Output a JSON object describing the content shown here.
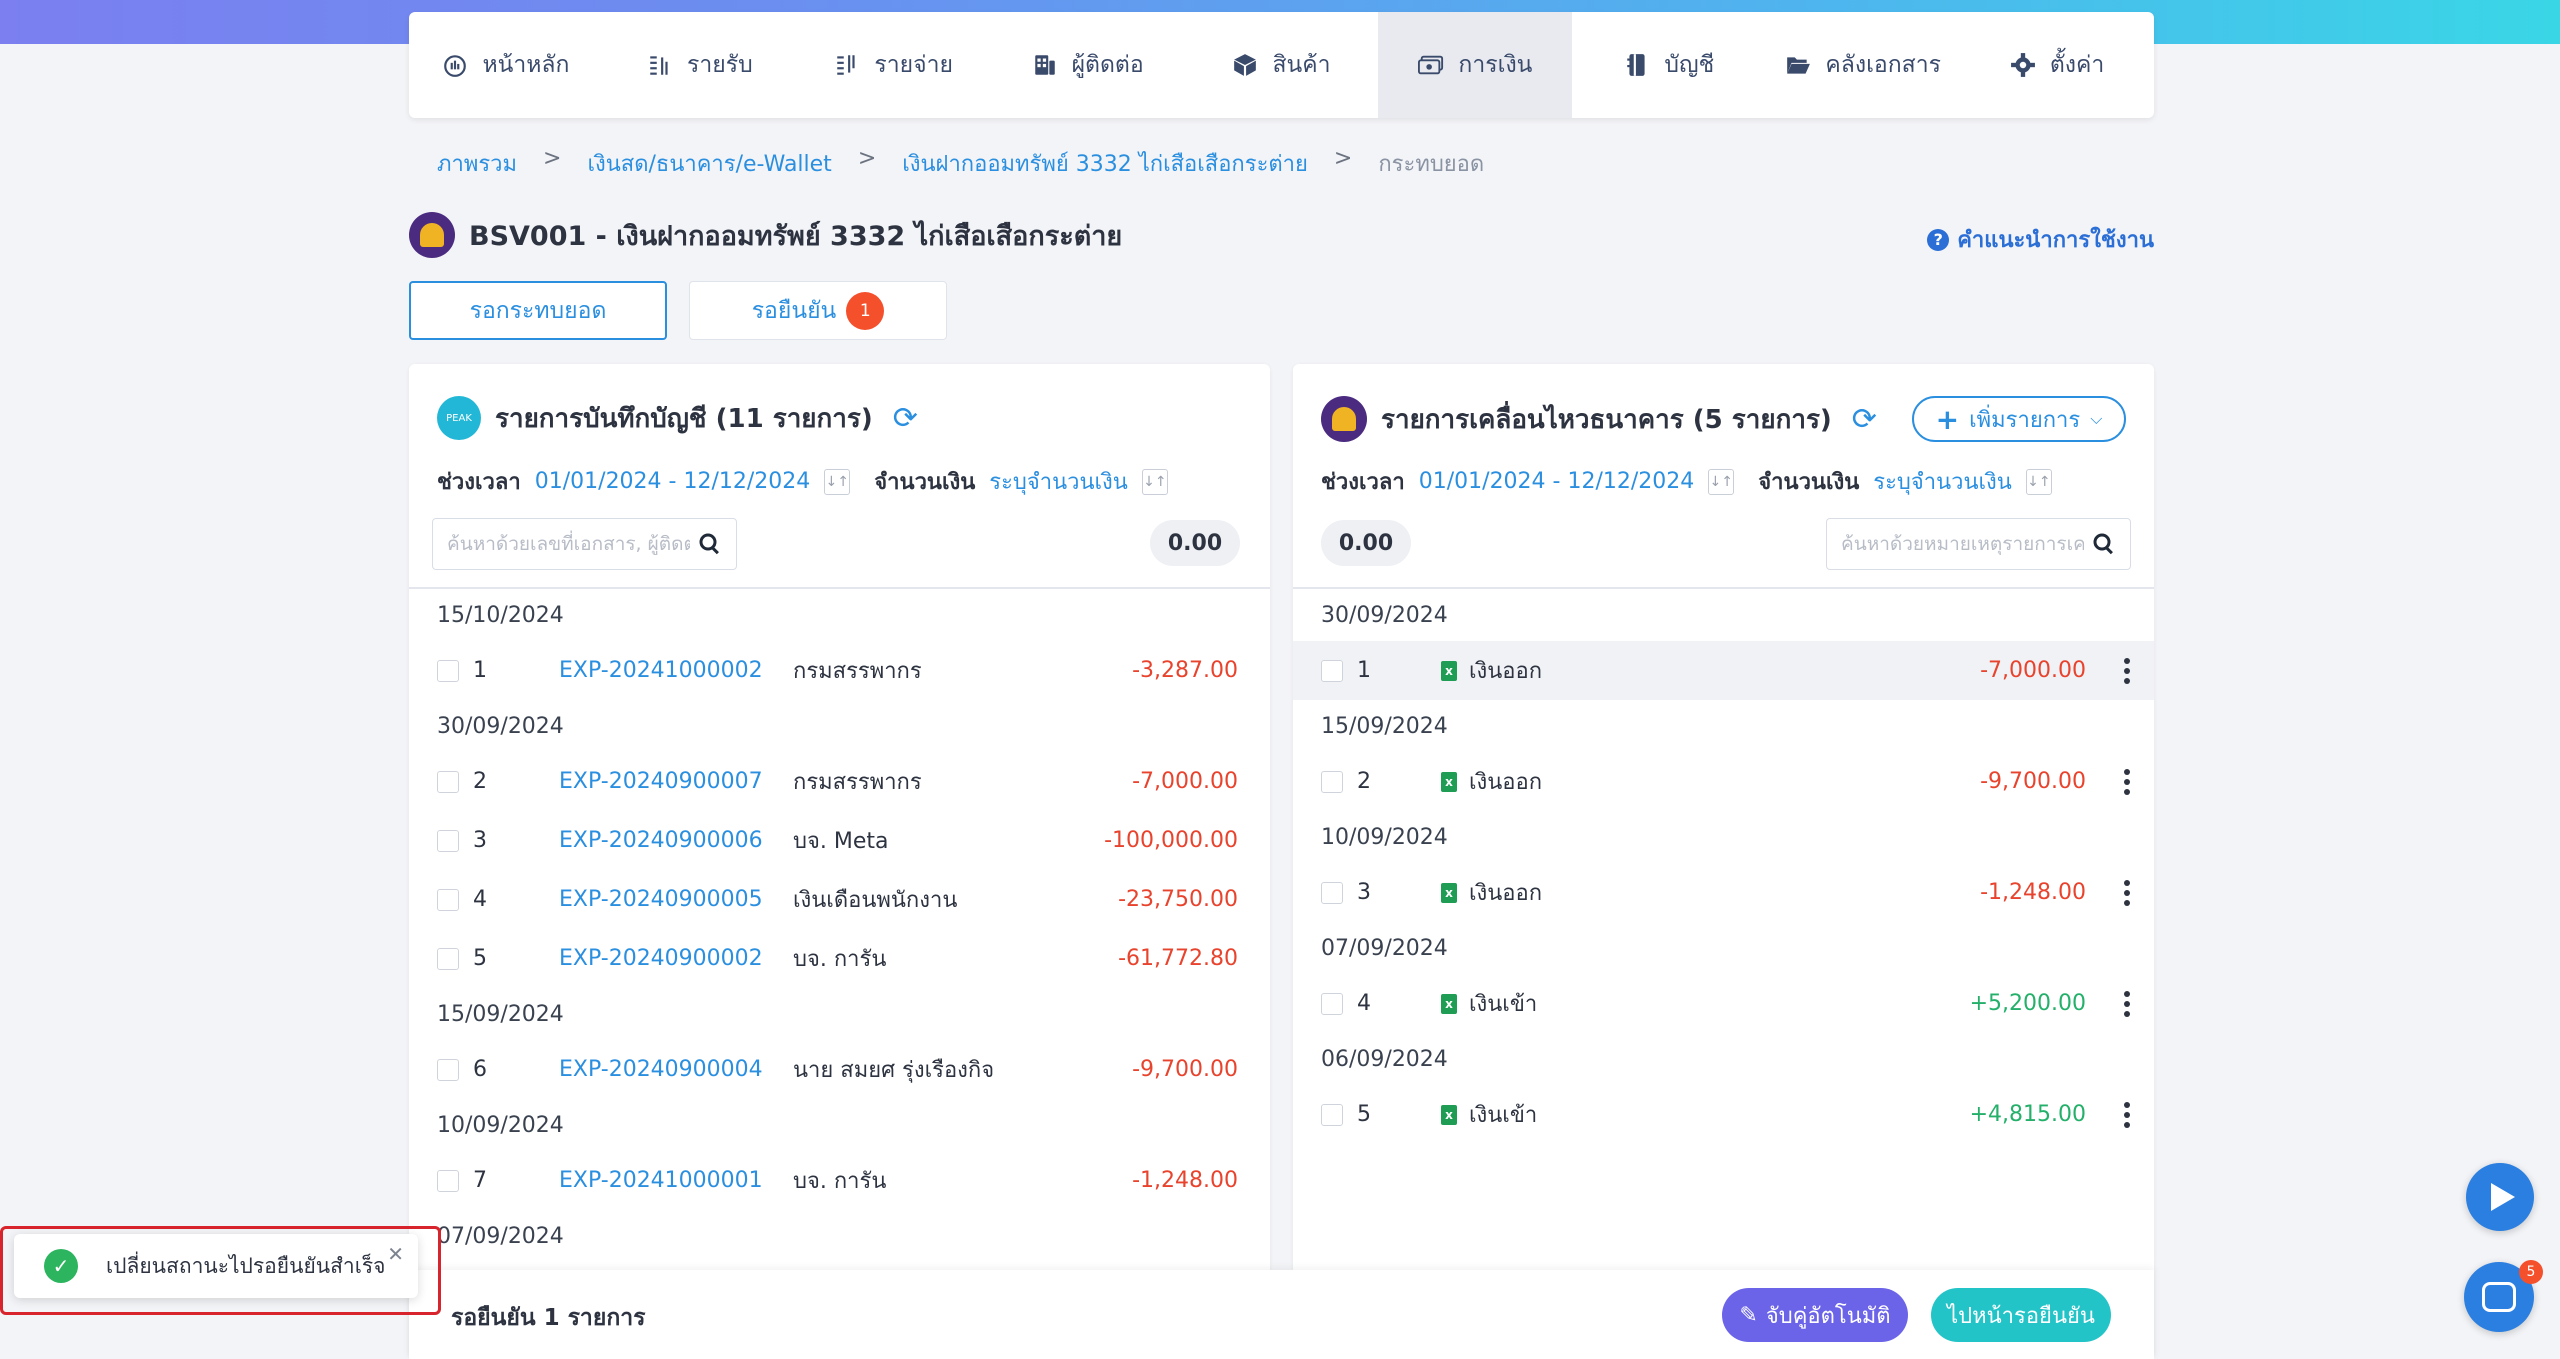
{
  "nav": {
    "items": [
      {
        "label": "หน้าหลัก",
        "icon": "dashboard-icon"
      },
      {
        "label": "รายรับ",
        "icon": "income-icon"
      },
      {
        "label": "รายจ่าย",
        "icon": "expense-icon"
      },
      {
        "label": "ผู้ติดต่อ",
        "icon": "contacts-icon"
      },
      {
        "label": "สินค้า",
        "icon": "box-icon"
      },
      {
        "label": "การเงิน",
        "icon": "money-icon",
        "active": true
      },
      {
        "label": "บัญชี",
        "icon": "ledger-icon"
      },
      {
        "label": "คลังเอกสาร",
        "icon": "folder-icon"
      },
      {
        "label": "ตั้งค่า",
        "icon": "gear-icon"
      }
    ]
  },
  "breadcrumb": {
    "items": [
      "ภาพรวม",
      "เงินสด/ธนาคาร/e-Wallet",
      "เงินฝากออมทรัพย์ 3332 ไก่เสือเสือกระต่าย"
    ],
    "current": "กระทบยอด",
    "separator": ">"
  },
  "page": {
    "title": "BSV001 - เงินฝากออมทรัพย์ 3332 ไก่เสือเสือกระต่าย",
    "help_label": "คำแนะนำการใช้งาน"
  },
  "tabs": {
    "reconcile_label": "รอกระทบยอด",
    "pending_label": "รอยืนยัน",
    "pending_count": "1"
  },
  "left_panel": {
    "logo_text": "PEAK",
    "title": "รายการบันทึกบัญชี (11 รายการ)",
    "period_label": "ช่วงเวลา",
    "period_value": "01/01/2024 - 12/12/2024",
    "amount_label": "จำนวนเงิน",
    "amount_value": "ระบุจำนวนเงิน",
    "search_placeholder": "ค้นหาด้วยเลขที่เอกสาร, ผู้ติดต",
    "total": "0.00",
    "groups": [
      {
        "date": "15/10/2024",
        "rows": [
          {
            "idx": "1",
            "doc": "EXP-20241000002",
            "contact": "กรมสรรพากร",
            "amount": "-3,287.00"
          }
        ]
      },
      {
        "date": "30/09/2024",
        "rows": [
          {
            "idx": "2",
            "doc": "EXP-20240900007",
            "contact": "กรมสรรพากร",
            "amount": "-7,000.00"
          },
          {
            "idx": "3",
            "doc": "EXP-20240900006",
            "contact": "บจ. Meta",
            "amount": "-100,000.00"
          },
          {
            "idx": "4",
            "doc": "EXP-20240900005",
            "contact": "เงินเดือนพนักงาน",
            "amount": "-23,750.00"
          },
          {
            "idx": "5",
            "doc": "EXP-20240900002",
            "contact": "บจ. การัน",
            "amount": "-61,772.80"
          }
        ]
      },
      {
        "date": "15/09/2024",
        "rows": [
          {
            "idx": "6",
            "doc": "EXP-20240900004",
            "contact": "นาย สมยศ รุ่งเรืองกิจ",
            "amount": "-9,700.00"
          }
        ]
      },
      {
        "date": "10/09/2024",
        "rows": [
          {
            "idx": "7",
            "doc": "EXP-20241000001",
            "contact": "บจ. การัน",
            "amount": "-1,248.00"
          }
        ]
      },
      {
        "date": "07/09/2024",
        "rows": []
      }
    ]
  },
  "right_panel": {
    "title": "รายการเคลื่อนไหวธนาคาร (5 รายการ)",
    "add_label": "เพิ่มรายการ",
    "period_label": "ช่วงเวลา",
    "period_value": "01/01/2024 - 12/12/2024",
    "amount_label": "จำนวนเงิน",
    "amount_value": "ระบุจำนวนเงิน",
    "search_placeholder": "ค้นหาด้วยหมายเหตุรายการเค",
    "total": "0.00",
    "groups": [
      {
        "date": "30/09/2024",
        "rows": [
          {
            "idx": "1",
            "type": "เงินออก",
            "amount": "-7,000.00",
            "sign": "neg",
            "highlight": true
          }
        ]
      },
      {
        "date": "15/09/2024",
        "rows": [
          {
            "idx": "2",
            "type": "เงินออก",
            "amount": "-9,700.00",
            "sign": "neg"
          }
        ]
      },
      {
        "date": "10/09/2024",
        "rows": [
          {
            "idx": "3",
            "type": "เงินออก",
            "amount": "-1,248.00",
            "sign": "neg"
          }
        ]
      },
      {
        "date": "07/09/2024",
        "rows": [
          {
            "idx": "4",
            "type": "เงินเข้า",
            "amount": "+5,200.00",
            "sign": "pos"
          }
        ]
      },
      {
        "date": "06/09/2024",
        "rows": [
          {
            "idx": "5",
            "type": "เงินเข้า",
            "amount": "+4,815.00",
            "sign": "pos"
          }
        ]
      }
    ]
  },
  "bottom_bar": {
    "pending_text": "รอยืนยัน 1 รายการ",
    "auto_match_label": "จับคู่อัตโนมัติ",
    "goto_pending_label": "ไปหน้ารอยืนยัน"
  },
  "toast": {
    "message": "เปลี่ยนสถานะไปรอยืนยันสำเร็จ"
  },
  "chat": {
    "badge": "5"
  },
  "colors": {
    "accent": "#2b8fe0",
    "negative": "#e8432d",
    "positive": "#24b06a",
    "auto_button": "#6b64e8",
    "goto_button": "#23c4c8"
  }
}
